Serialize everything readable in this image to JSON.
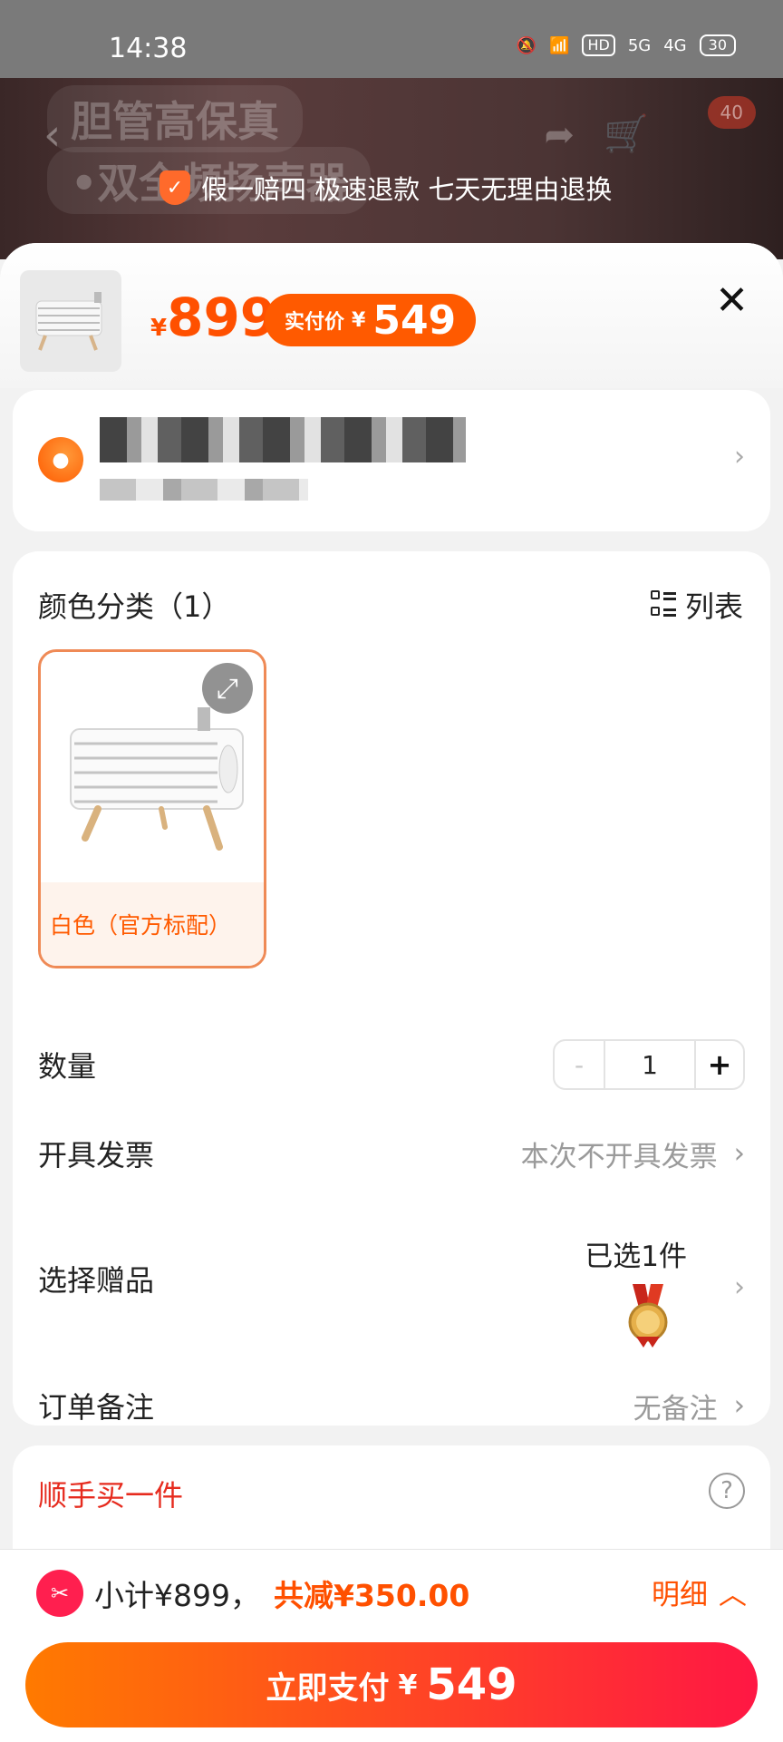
{
  "status": {
    "time": "14:38",
    "hd": "HD",
    "sig1": "5G",
    "sig2": "4G",
    "battery": "30"
  },
  "backdrop": {
    "line1": "胆管高保真",
    "line2": "•双全频扬声器",
    "cart_badge": "40",
    "guarantee": "假一赔四 极速退款 七天无理由退换"
  },
  "header": {
    "currency": "¥",
    "price": "899",
    "pay_label": "实付价",
    "pay_currency": "¥",
    "pay_amount": "549"
  },
  "spec": {
    "title": "颜色分类（1）",
    "view_toggle": "列表",
    "options": [
      {
        "label": "白色（官方标配）",
        "selected": true
      }
    ]
  },
  "quantity": {
    "label": "数量",
    "minus": "-",
    "value": "1",
    "plus": "+"
  },
  "invoice": {
    "label": "开具发票",
    "value": "本次不开具发票"
  },
  "gift": {
    "label": "选择赠品",
    "value": "已选1件"
  },
  "note": {
    "label": "订单备注",
    "value": "无备注"
  },
  "addon": {
    "title": "顺手买一件"
  },
  "footer": {
    "subtotal": "小计¥899，",
    "reduce": "共减¥350.00",
    "detail": "明细",
    "pay_label": "立即支付",
    "pay_currency": "¥",
    "pay_amount": "549"
  },
  "colors": {
    "accent": "#ff5000",
    "pay_start": "#ff7a00",
    "pay_end": "#ff1744",
    "addon_title": "#e62b1e"
  }
}
